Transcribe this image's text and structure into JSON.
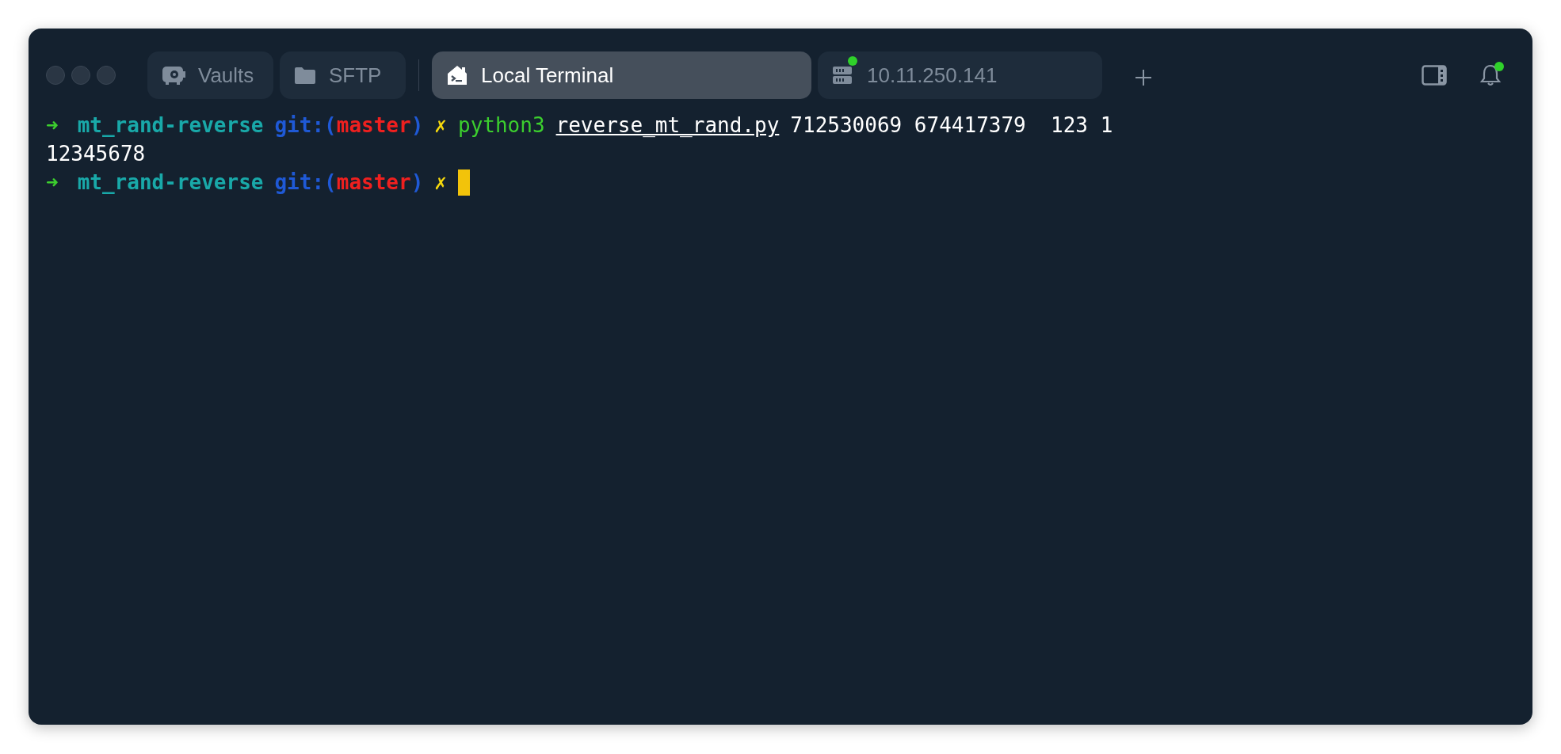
{
  "tabs": [
    {
      "kind": "vault",
      "label": "Vaults",
      "selected": false
    },
    {
      "kind": "sftp",
      "label": "SFTP",
      "selected": false
    },
    {
      "kind": "local",
      "label": "Local Terminal",
      "selected": true
    },
    {
      "kind": "host",
      "label": "10.11.250.141",
      "selected": false,
      "connected": true
    }
  ],
  "notifications": {
    "unread": true
  },
  "terminal": {
    "lines": [
      {
        "segments": [
          {
            "kind": "arrow",
            "text": "➜"
          },
          {
            "kind": "dir",
            "text": "mt_rand-reverse"
          },
          {
            "kind": "git",
            "text": "git:("
          },
          {
            "kind": "branch",
            "text": "master"
          },
          {
            "kind": "git",
            "text": ")"
          },
          {
            "kind": "dirty",
            "text": "✗"
          },
          {
            "kind": "command",
            "text": "python3"
          },
          {
            "kind": "path",
            "text": "reverse_mt_rand.py"
          },
          {
            "kind": "plain",
            "text": "712530069 674417379  123 1"
          }
        ]
      },
      {
        "segments": [
          {
            "kind": "output",
            "text": "12345678"
          }
        ]
      },
      {
        "segments": [
          {
            "kind": "arrow",
            "text": "➜"
          },
          {
            "kind": "dir",
            "text": "mt_rand-reverse"
          },
          {
            "kind": "git",
            "text": "git:("
          },
          {
            "kind": "branch",
            "text": "master"
          },
          {
            "kind": "git",
            "text": ")"
          },
          {
            "kind": "dirty",
            "text": "✗"
          }
        ],
        "cursor": true
      }
    ]
  }
}
